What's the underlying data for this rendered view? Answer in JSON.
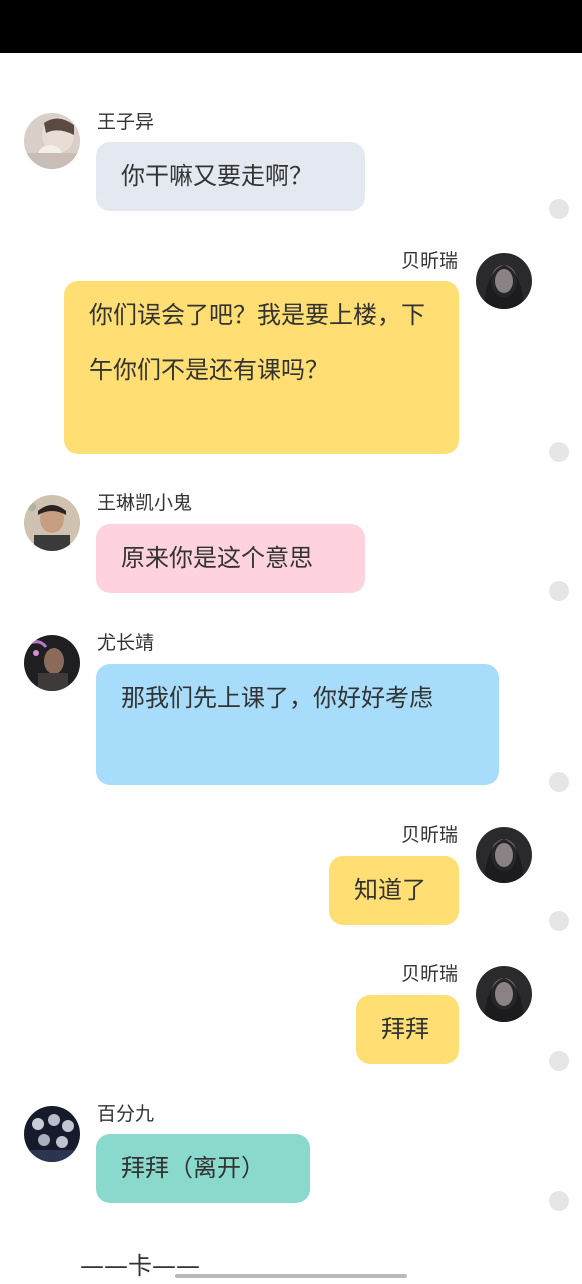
{
  "colors": {
    "gray_bubble": "#e4e9f1",
    "yellow_bubble": "#ffde74",
    "pink_bubble": "#ffd3de",
    "blue_bubble": "#a7dcfb",
    "teal_bubble": "#8ad9cd",
    "status_bar": "#000000",
    "dot": "#e6e6e6"
  },
  "messages": [
    {
      "sender": "王子异",
      "text": "你干嘛又要走啊？",
      "side": "left",
      "avatar": "avatar-wangziyi"
    },
    {
      "sender": "贝昕瑞",
      "text": "你们误会了吧？我是要上楼，下午你们不是还有课吗？",
      "side": "right",
      "avatar": "avatar-beixinrui"
    },
    {
      "sender": "王琳凯小鬼",
      "text": "原来你是这个意思",
      "side": "left",
      "avatar": "avatar-wanglinkai"
    },
    {
      "sender": "尤长靖",
      "text": "那我们先上课了，你好好考虑",
      "side": "left",
      "avatar": "avatar-youzhangjing"
    },
    {
      "sender": "贝昕瑞",
      "text": "知道了",
      "side": "right",
      "avatar": "avatar-beixinrui"
    },
    {
      "sender": "贝昕瑞",
      "text": "拜拜",
      "side": "right",
      "avatar": "avatar-beixinrui"
    },
    {
      "sender": "百分九",
      "text": "拜拜（离开）",
      "side": "left",
      "avatar": "avatar-baifenjiu"
    }
  ],
  "footer": {
    "text": "——卡——"
  }
}
